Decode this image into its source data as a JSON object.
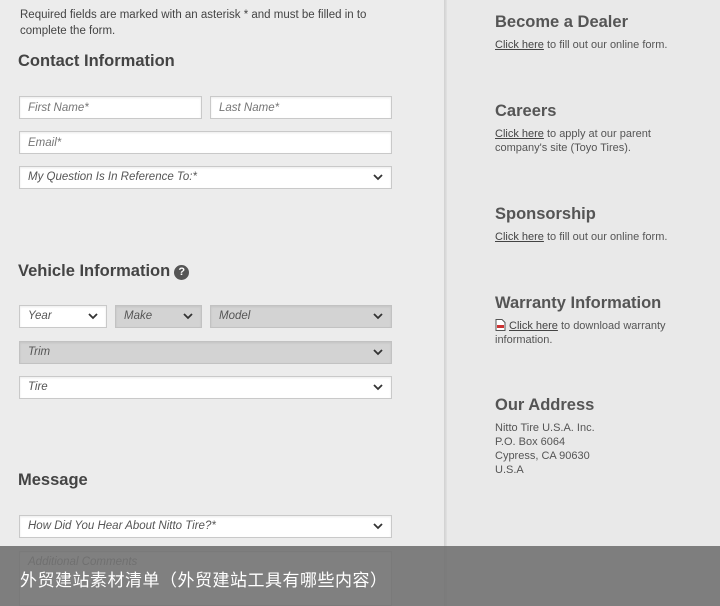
{
  "form": {
    "required_note": "Required fields are marked with an asterisk * and must be filled in to complete the form.",
    "contact": {
      "title": "Contact Information",
      "first_name_placeholder": "First Name*",
      "last_name_placeholder": "Last Name*",
      "email_placeholder": "Email*",
      "question_select": "My Question Is In Reference To:*"
    },
    "vehicle": {
      "title": "Vehicle Information",
      "help_glyph": "?",
      "year_select": "Year",
      "make_select": "Make",
      "model_select": "Model",
      "trim_select": "Trim",
      "tire_select": "Tire"
    },
    "message": {
      "title": "Message",
      "heard_select": "How Did You Hear About Nitto Tire?*",
      "comments_placeholder": "Additional Comments"
    }
  },
  "sidebar": {
    "dealer": {
      "title": "Become a Dealer",
      "link": "Click here",
      "text": " to fill out our online form."
    },
    "careers": {
      "title": "Careers",
      "link": "Click here",
      "text": " to apply at our parent company's site (Toyo Tires)."
    },
    "sponsorship": {
      "title": "Sponsorship",
      "link": "Click here",
      "text": " to fill out our online form."
    },
    "warranty": {
      "title": "Warranty Information",
      "link": "Click here",
      "text": " to download warranty information."
    },
    "address": {
      "title": "Our Address",
      "line1": "Nitto Tire U.S.A. Inc.",
      "line2": "P.O. Box 6064",
      "line3": "Cypress, CA 90630",
      "line4": "U.S.A"
    }
  },
  "banner": {
    "text": "外贸建站素材清单（外贸建站工具有哪些内容）"
  },
  "icons": {
    "dropdown": "chevron-down-icon",
    "help": "question-circle-icon",
    "pdf": "pdf-file-icon"
  }
}
